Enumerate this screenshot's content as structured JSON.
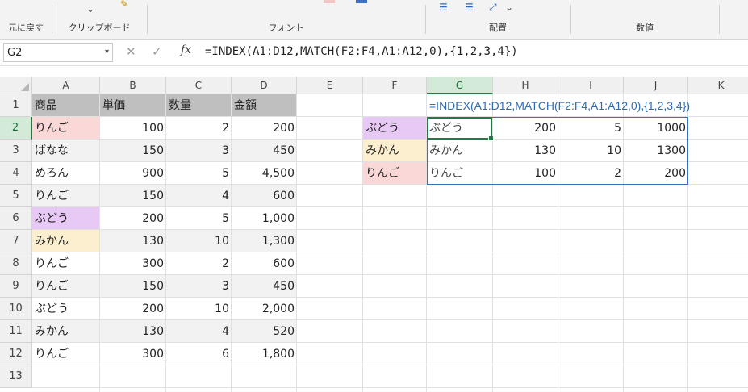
{
  "ribbon": {
    "undo_label": "元に戻す",
    "clipboard_label": "クリップボード",
    "font_label": "フォント",
    "alignment_label": "配置",
    "number_label": "数値"
  },
  "formula_bar": {
    "name_box": "G2",
    "formula": "=INDEX(A1:D12,MATCH(F2:F4,A1:A12,0),{1,2,3,4})"
  },
  "columns": [
    "A",
    "B",
    "C",
    "D",
    "E",
    "F",
    "G",
    "H",
    "I",
    "J",
    "K"
  ],
  "rows": [
    "1",
    "2",
    "3",
    "4",
    "5",
    "6",
    "7",
    "8",
    "9",
    "10",
    "11",
    "12",
    "13"
  ],
  "table": {
    "headers": [
      "商品",
      "単価",
      "数量",
      "金額"
    ],
    "rows": [
      [
        "りんご",
        "100",
        "2",
        "200"
      ],
      [
        "ばなな",
        "150",
        "3",
        "450"
      ],
      [
        "めろん",
        "900",
        "5",
        "4,500"
      ],
      [
        "りんご",
        "150",
        "4",
        "600"
      ],
      [
        "ぶどう",
        "200",
        "5",
        "1,000"
      ],
      [
        "みかん",
        "130",
        "10",
        "1,300"
      ],
      [
        "りんご",
        "300",
        "2",
        "600"
      ],
      [
        "りんご",
        "150",
        "3",
        "450"
      ],
      [
        "ぶどう",
        "200",
        "10",
        "2,000"
      ],
      [
        "みかん",
        "130",
        "4",
        "520"
      ],
      [
        "りんご",
        "300",
        "6",
        "1,800"
      ]
    ]
  },
  "lookup": {
    "keys": [
      "ぶどう",
      "みかん",
      "りんご"
    ],
    "formula_text": "=INDEX(A1:D12,MATCH(F2:F4,A1:A12,0),{1,2,3,4})",
    "results": [
      [
        "ぶどう",
        "200",
        "5",
        "1000"
      ],
      [
        "みかん",
        "130",
        "10",
        "1300"
      ],
      [
        "りんご",
        "100",
        "2",
        "200"
      ]
    ]
  },
  "colors": {
    "ringo": "#fbd8d8",
    "budou": "#e8c9f5",
    "mikan": "#fcefcf",
    "header_gray": "#bfbfbf",
    "selection_green": "#1f7a45",
    "spill_blue": "#3b6fc4"
  }
}
